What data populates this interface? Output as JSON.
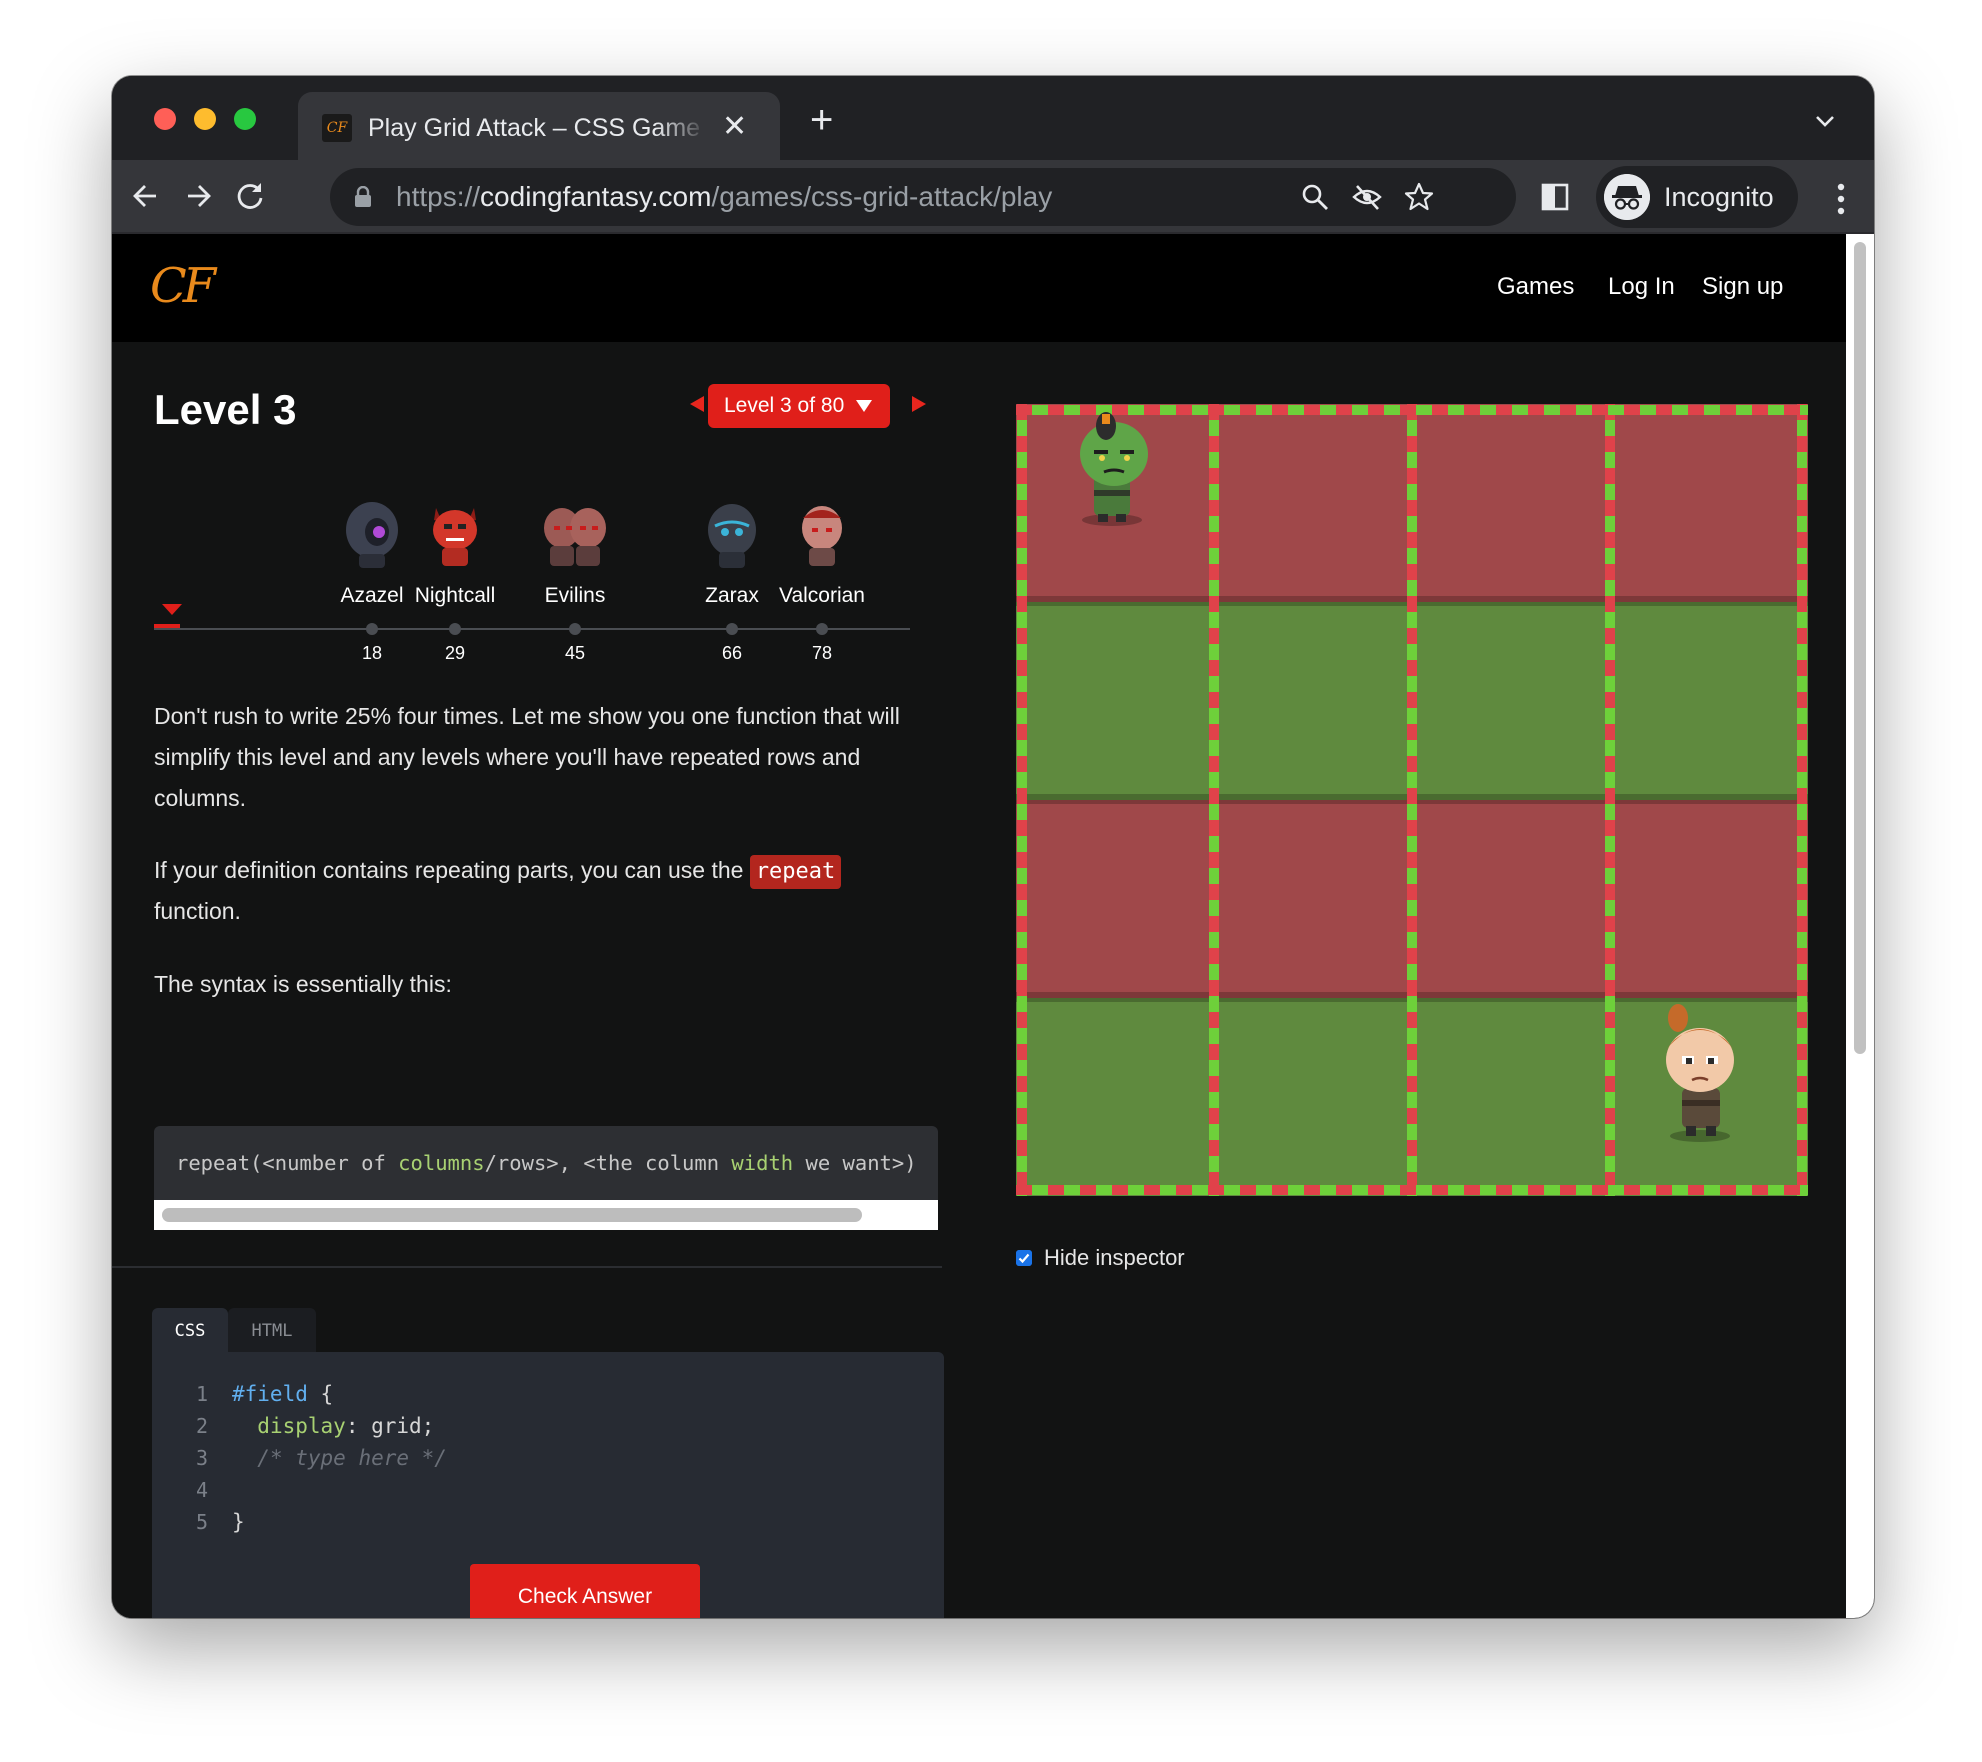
{
  "browser": {
    "tab_title": "Play Grid Attack – CSS Game to Learn CSS Grid",
    "favicon_text": "CF",
    "url_scheme": "https://",
    "url_host": "codingfantasy.com",
    "url_path": "/games/css-grid-attack/play",
    "profile_label": "Incognito"
  },
  "site": {
    "logo": "CF",
    "logo_color": "#e98a1c",
    "nav": [
      "Games",
      "Log In",
      "Sign up"
    ]
  },
  "level": {
    "title": "Level 3",
    "selector": "Level 3 of 80",
    "accent": "#e01f1a"
  },
  "bosses": [
    {
      "name": "Azazel",
      "level": "18",
      "icon": "azazel-boss-icon"
    },
    {
      "name": "Nightcall",
      "level": "29",
      "icon": "nightcall-boss-icon"
    },
    {
      "name": "Evilins",
      "level": "45",
      "icon": "evilins-boss-icon"
    },
    {
      "name": "Zarax",
      "level": "66",
      "icon": "zarax-boss-icon"
    },
    {
      "name": "Valcorian",
      "level": "78",
      "icon": "valcorian-boss-icon"
    }
  ],
  "instructions": {
    "p1": "Don't rush to write 25% four times. Let me show you one function that will simplify this level and any levels where you'll have repeated rows and columns.",
    "p2_before": "If your definition contains repeating parts, you can use the ",
    "p2_code": "repeat",
    "p2_after": " function.",
    "p3": "The syntax is essentially this:",
    "snippet": {
      "t1": "repeat(<number of ",
      "k1": "columns",
      "t2": "/rows>, <the column ",
      "k2": "width",
      "t3": " we want>)"
    }
  },
  "editor": {
    "tabs": [
      "CSS",
      "HTML"
    ],
    "active_tab": "CSS",
    "line_numbers": [
      "1",
      "2",
      "3",
      "4",
      "5"
    ],
    "selector": "#field",
    "open_brace": " {",
    "property": "display",
    "value": ": grid;",
    "comment": "/* type here */",
    "close_brace": "}",
    "check_button": "Check Answer"
  },
  "board": {
    "rows": 4,
    "cols": 4,
    "row_colors": [
      "#a0484a",
      "#5f8a3e",
      "#a0484a",
      "#5f8a3e"
    ],
    "characters": [
      "orc-enemy-icon",
      "elf-hero-icon"
    ]
  },
  "hide_inspector": {
    "label": "Hide inspector",
    "checked": true
  }
}
